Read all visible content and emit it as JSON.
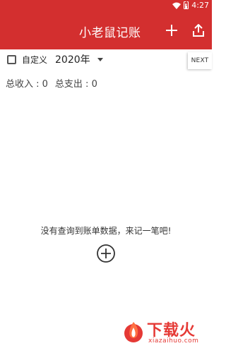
{
  "status_bar": {
    "time": "4:27",
    "icons": [
      "wifi-icon",
      "battery-alert-icon"
    ]
  },
  "toolbar": {
    "title": "小老鼠记账",
    "actions": [
      "add-icon",
      "share-icon"
    ],
    "color": "#d32f2f"
  },
  "filter": {
    "custom_label": "自定义",
    "custom_checked": false,
    "year": "2020年",
    "next_label": "NEXT"
  },
  "summary": {
    "income": "总收入 : 0",
    "expense": "总支出 : 0"
  },
  "empty_state": {
    "message": "没有查询到账单数据，来记一笔吧!",
    "icon": "add-circle-icon"
  },
  "watermark": {
    "brand": "下载火",
    "domain": "xiazaihuo.com",
    "color": "#e53935"
  }
}
